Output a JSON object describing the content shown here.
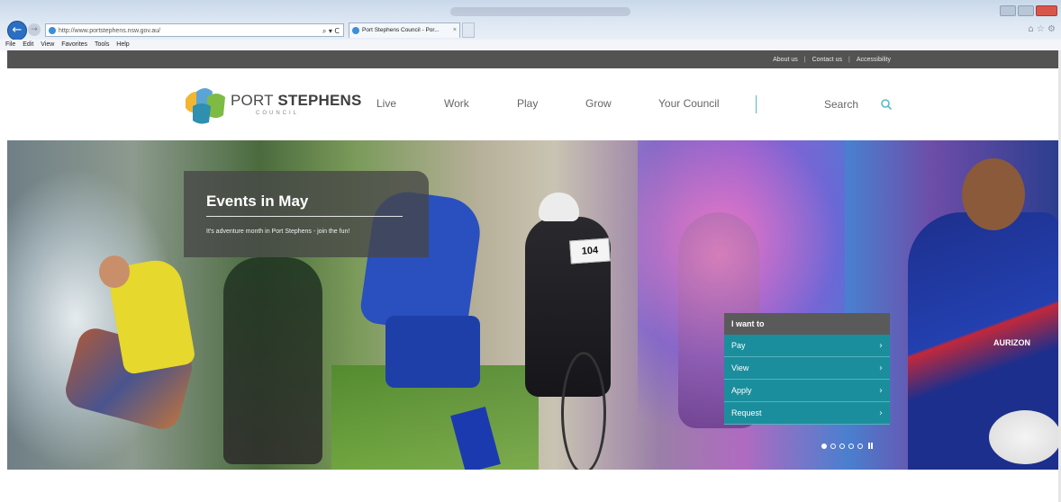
{
  "browser": {
    "address": "http://www.portstephens.nsw.gov.au/",
    "address_tools": "⌕ ▾ C",
    "tab_title": "Port Stephens Council - Por...",
    "tab_close": "×",
    "back_icon": "←",
    "forward_icon": "→",
    "right_icons": "⌂ ☆ ⚙",
    "menu": [
      "File",
      "Edit",
      "View",
      "Favorites",
      "Tools",
      "Help"
    ]
  },
  "utility_nav": {
    "links": [
      "About us",
      "Contact us",
      "Accessibility"
    ],
    "separator": "|"
  },
  "header": {
    "logo_text_light": "PORT ",
    "logo_text_bold": "STEPHENS",
    "logo_sub": "COUNCIL",
    "nav": [
      "Live",
      "Work",
      "Play",
      "Grow",
      "Your Council"
    ],
    "search_label": "Search"
  },
  "hero": {
    "events_title": "Events in May",
    "events_sub": "It's adventure month in Port Stephens - join the fun!",
    "bib_number": "104",
    "sponsor": "AURIZON",
    "i_want_to": {
      "heading": "I want to",
      "items": [
        "Pay",
        "View",
        "Apply",
        "Request"
      ],
      "chevron": "›"
    },
    "slider": {
      "count": 5,
      "active_index": 0
    }
  },
  "colors": {
    "util_bar": "#535353",
    "accent_teal": "#1a8e9c",
    "events_box": "rgba(70,70,70,0.78)"
  }
}
